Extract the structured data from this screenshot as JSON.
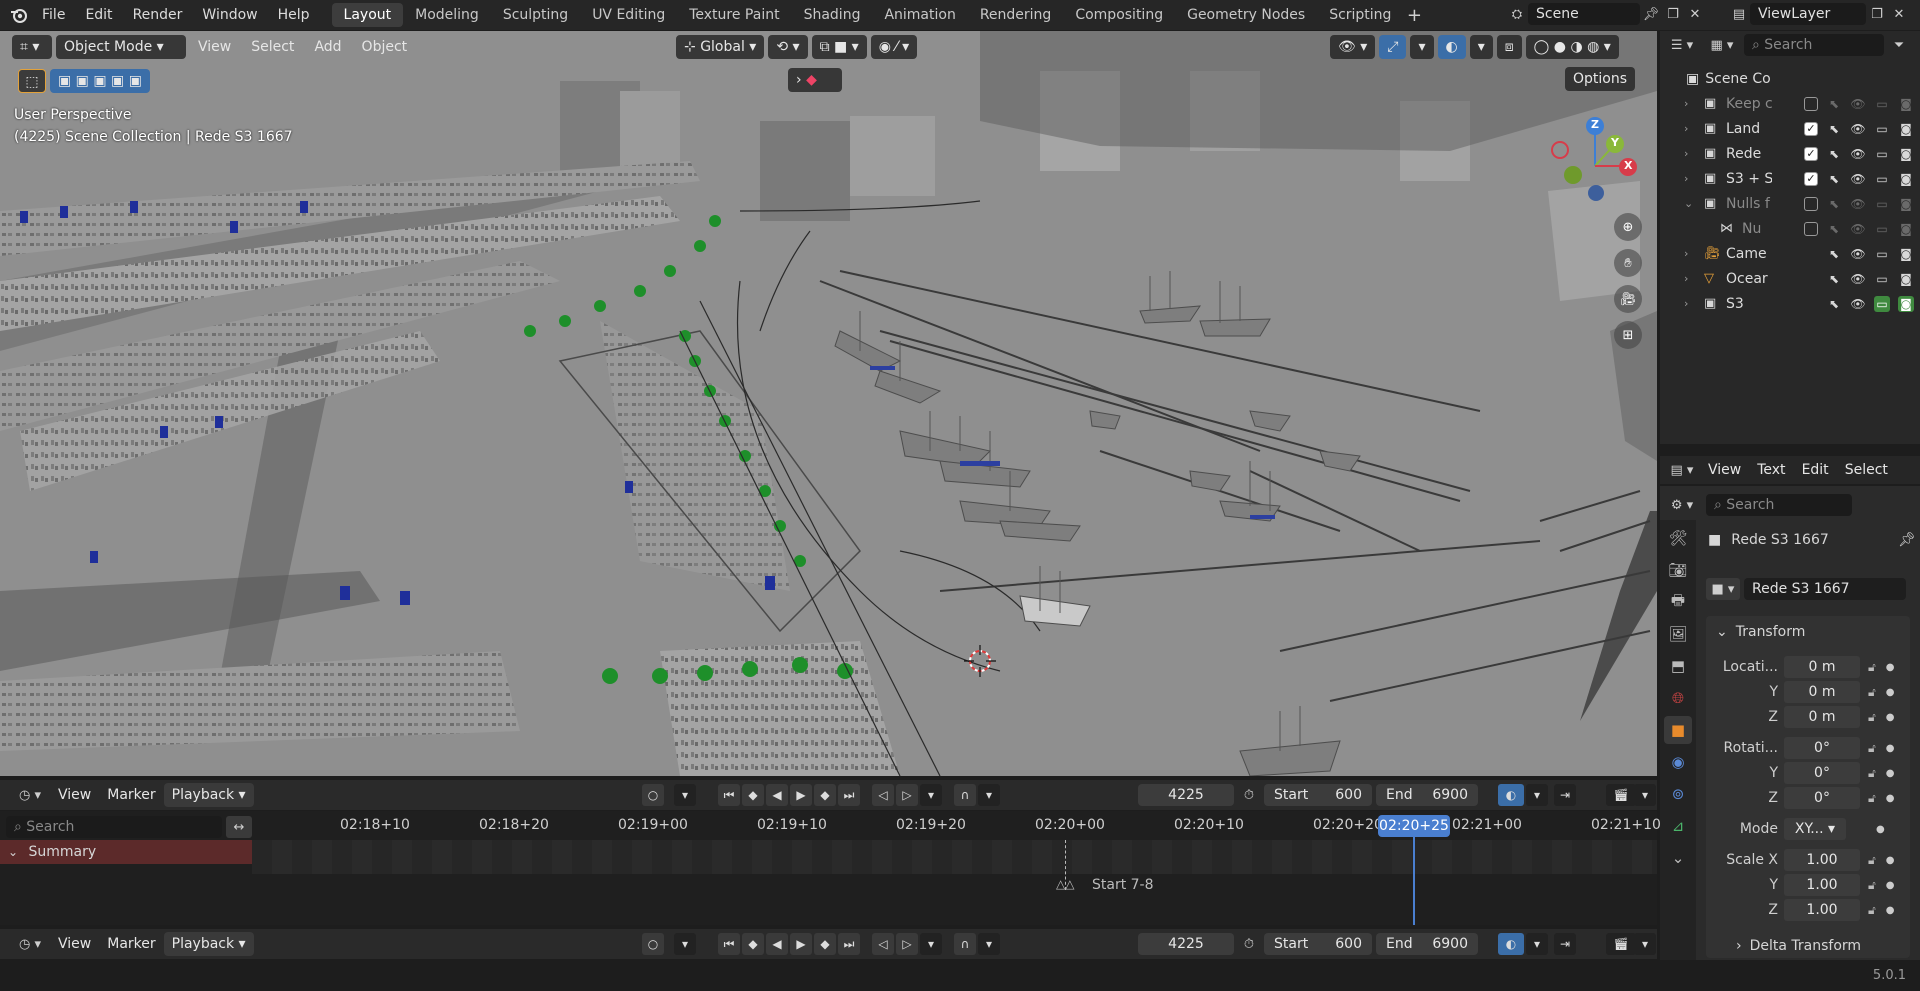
{
  "app": {
    "version": "5.0.1"
  },
  "menu": [
    "File",
    "Edit",
    "Render",
    "Window",
    "Help"
  ],
  "workspaces": [
    {
      "label": "Layout",
      "active": true
    },
    {
      "label": "Modeling"
    },
    {
      "label": "Sculpting"
    },
    {
      "label": "UV Editing"
    },
    {
      "label": "Texture Paint"
    },
    {
      "label": "Shading"
    },
    {
      "label": "Animation"
    },
    {
      "label": "Rendering"
    },
    {
      "label": "Compositing"
    },
    {
      "label": "Geometry Nodes"
    },
    {
      "label": "Scripting"
    }
  ],
  "add_workspace_icon": "plus-icon",
  "scene": {
    "value": "Scene"
  },
  "view_layer": {
    "value": "ViewLayer"
  },
  "viewport": {
    "mode": "Object Mode",
    "menus": [
      "View",
      "Select",
      "Add",
      "Object"
    ],
    "orientation": "Global",
    "options_label": "Options",
    "overlay_title": "User Perspective",
    "overlay_sub": "(4225) Scene Collection | Rede S3 1667",
    "gizmo": {
      "z": "Z",
      "y": "Y",
      "x": "X"
    },
    "background_color": "#8e8e8e"
  },
  "outliner": {
    "search_placeholder": "Search",
    "root": "Scene Co",
    "items": [
      {
        "label": "Keep c",
        "dim": true,
        "checked": false
      },
      {
        "label": "Land",
        "checked": true
      },
      {
        "label": "Rede",
        "checked": true
      },
      {
        "label": "S3 + S",
        "checked": true
      },
      {
        "label": "Nulls f",
        "dim": true,
        "checked": false
      },
      {
        "label": "Nu",
        "dim": true,
        "checked": false,
        "child": true
      },
      {
        "label": "Came"
      },
      {
        "label": "Ocear"
      },
      {
        "label": "S3"
      }
    ]
  },
  "props_header": {
    "menus": [
      "View",
      "Text",
      "Edit",
      "Select"
    ]
  },
  "props": {
    "search_placeholder": "Search",
    "object_name": "Rede S3 1667",
    "data_name": "Rede S3 1667",
    "transform_label": "Transform",
    "location_label": "Locati...",
    "location": [
      "0 m",
      "0 m",
      "0 m"
    ],
    "rotation_label": "Rotati...",
    "rotation": [
      "0°",
      "0°",
      "0°"
    ],
    "mode_label": "Mode",
    "mode_value": "XY...",
    "scale_label": "Scale X",
    "scale": [
      "1.00",
      "1.00",
      "1.00"
    ],
    "axis_y": "Y",
    "axis_z": "Z",
    "delta_label": "Delta Transform"
  },
  "timeline": {
    "menus": [
      "View",
      "Marker",
      "Playback"
    ],
    "current_frame": "4225",
    "start_label": "Start",
    "start": "600",
    "end_label": "End",
    "end": "6900",
    "search_placeholder": "Search",
    "summary_label": "Summary",
    "ticks": [
      "02:18+10",
      "02:18+20",
      "02:19+00",
      "02:19+10",
      "02:19+20",
      "02:20+00",
      "02:20+10",
      "02:20+20",
      "02:21+00",
      "02:21+10"
    ],
    "current_time": "02:20+25",
    "marker_label": "Start 7-8"
  }
}
